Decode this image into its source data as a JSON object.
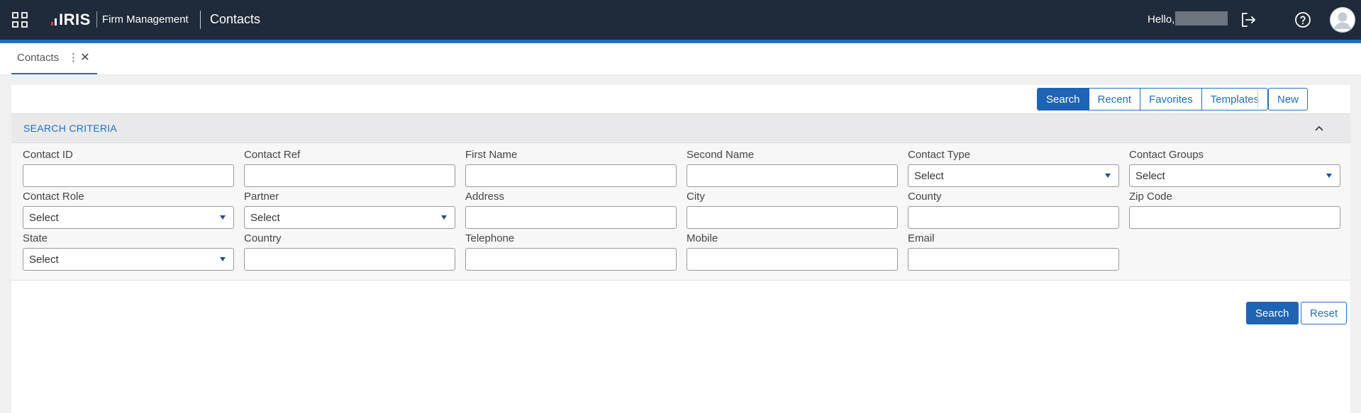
{
  "header": {
    "logo_text": "IRIS",
    "app_name": "Firm Management",
    "page_title": "Contacts",
    "greeting": "Hello,"
  },
  "tabs": [
    {
      "label": "Contacts",
      "menu_glyph": "⋮",
      "close_glyph": "✕"
    }
  ],
  "toolbar": {
    "views": [
      {
        "label": "Search",
        "active": true
      },
      {
        "label": "Recent",
        "active": false
      },
      {
        "label": "Favorites",
        "active": false
      },
      {
        "label": "Templates",
        "active": false
      }
    ],
    "new_label": "New"
  },
  "criteria": {
    "title": "SEARCH CRITERIA",
    "fields": [
      {
        "label": "Contact ID",
        "type": "text",
        "value": ""
      },
      {
        "label": "Contact Ref",
        "type": "text",
        "value": ""
      },
      {
        "label": "First Name",
        "type": "text",
        "value": ""
      },
      {
        "label": "Second Name",
        "type": "text",
        "value": ""
      },
      {
        "label": "Contact Type",
        "type": "select",
        "value": "Select"
      },
      {
        "label": "Contact Groups",
        "type": "select",
        "value": "Select"
      },
      {
        "label": "Contact Role",
        "type": "select",
        "value": "Select"
      },
      {
        "label": "Partner",
        "type": "select",
        "value": "Select"
      },
      {
        "label": "Address",
        "type": "text",
        "value": ""
      },
      {
        "label": "City",
        "type": "text",
        "value": ""
      },
      {
        "label": "County",
        "type": "text",
        "value": ""
      },
      {
        "label": "Zip Code",
        "type": "text",
        "value": ""
      },
      {
        "label": "State",
        "type": "select",
        "value": "Select"
      },
      {
        "label": "Country",
        "type": "text",
        "value": ""
      },
      {
        "label": "Telephone",
        "type": "text",
        "value": ""
      },
      {
        "label": "Mobile",
        "type": "text",
        "value": ""
      },
      {
        "label": "Email",
        "type": "text",
        "value": ""
      }
    ]
  },
  "actions": {
    "search_label": "Search",
    "reset_label": "Reset"
  },
  "icons": {
    "apps": "apps-grid-icon",
    "logout": "logout-icon",
    "help": "help-icon",
    "avatar": "avatar-icon",
    "collapse": "chevron-up-icon",
    "dropdown": "caret-down-icon"
  },
  "colors": {
    "header_bg": "#1f2a3a",
    "accent": "#1e6fc7",
    "primary_button": "#1e63b4"
  }
}
